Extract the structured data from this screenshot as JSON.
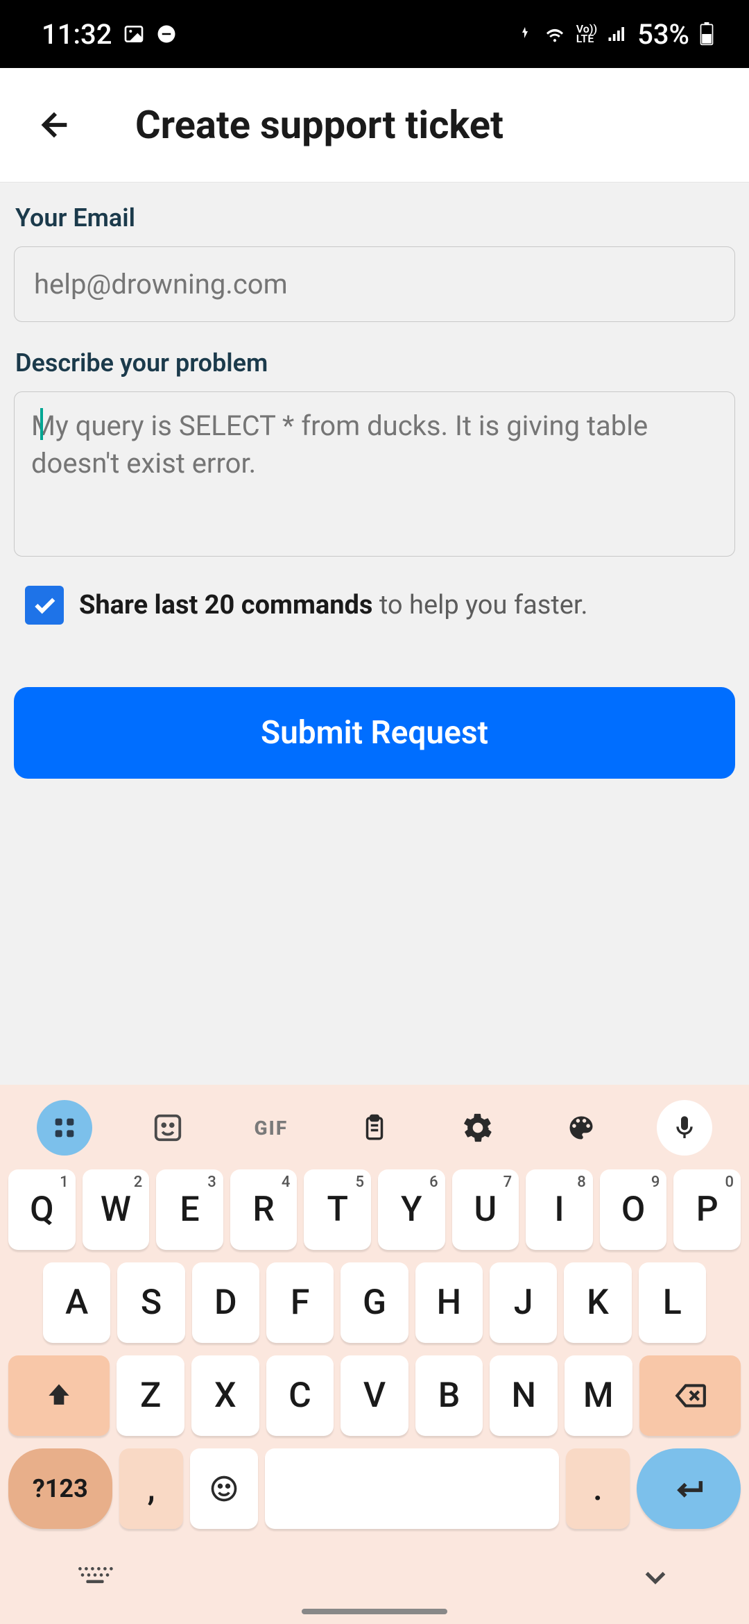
{
  "statusbar": {
    "time": "11:32",
    "battery_pct": "53%"
  },
  "titlebar": {
    "title": "Create support ticket"
  },
  "form": {
    "email_label": "Your Email",
    "email_placeholder": "help@drowning.com",
    "problem_label": "Describe your problem",
    "problem_placeholder": "My query is SELECT * from ducks. It is giving table doesn't exist error.",
    "share_bold": "Share last 20 commands",
    "share_rest": " to help you faster.",
    "share_checked": true,
    "submit_label": "Submit Request"
  },
  "keyboard": {
    "gif": "GIF",
    "row1": [
      {
        "k": "Q",
        "n": "1"
      },
      {
        "k": "W",
        "n": "2"
      },
      {
        "k": "E",
        "n": "3"
      },
      {
        "k": "R",
        "n": "4"
      },
      {
        "k": "T",
        "n": "5"
      },
      {
        "k": "Y",
        "n": "6"
      },
      {
        "k": "U",
        "n": "7"
      },
      {
        "k": "I",
        "n": "8"
      },
      {
        "k": "O",
        "n": "9"
      },
      {
        "k": "P",
        "n": "0"
      }
    ],
    "row2": [
      "A",
      "S",
      "D",
      "F",
      "G",
      "H",
      "J",
      "K",
      "L"
    ],
    "row3": [
      "Z",
      "X",
      "C",
      "V",
      "B",
      "N",
      "M"
    ],
    "numkey": "?123",
    "comma": ",",
    "period": "."
  }
}
